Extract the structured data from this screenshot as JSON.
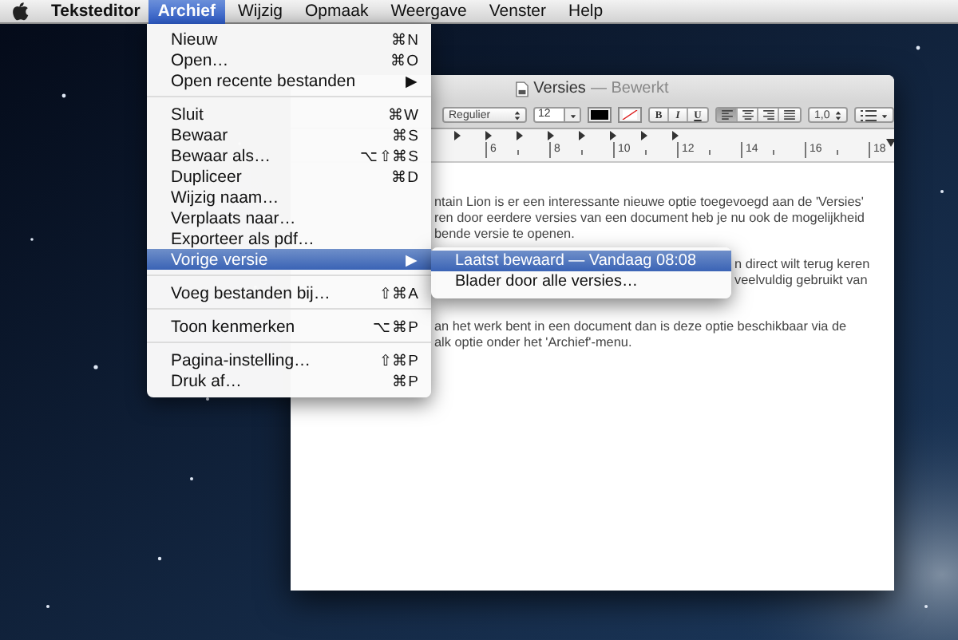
{
  "menubar": {
    "app": "Teksteditor",
    "items": [
      {
        "label": "Archief",
        "selected": true
      },
      {
        "label": "Wijzig",
        "selected": false
      },
      {
        "label": "Opmaak",
        "selected": false
      },
      {
        "label": "Weergave",
        "selected": false
      },
      {
        "label": "Venster",
        "selected": false
      },
      {
        "label": "Help",
        "selected": false
      }
    ]
  },
  "window": {
    "title": "Versies",
    "status": "— Bewerkt",
    "toolbar": {
      "font_style": "Regulier",
      "font_size": "12",
      "style_buttons": [
        "B",
        "I",
        "U"
      ],
      "alignment": [
        {
          "selected": true
        },
        {
          "selected": false
        },
        {
          "selected": false
        },
        {
          "selected": false
        }
      ],
      "line_spacing": "1,0"
    },
    "ruler": [
      "6",
      "8",
      "10",
      "12",
      "14",
      "16",
      "18"
    ],
    "paragraphs": [
      {
        "lines": [
          "ntain Lion is er een interessante nieuwe optie toegevoegd aan de 'Versies'",
          "ren door eerdere versies van een document heb je nu ook de mogelijkheid",
          "bende versie te openen."
        ]
      },
      {
        "lines": [
          "n direct wilt terug keren",
          "veelvuldig gebruikt van"
        ]
      },
      {
        "lines": [
          "an het werk bent in een document dan is deze optie beschikbaar via de",
          "alk optie onder het 'Archief'-menu."
        ]
      }
    ]
  },
  "menu": {
    "groups": [
      [
        {
          "label": "Nieuw",
          "shortcut": "⌘N",
          "selected": false
        },
        {
          "label": "Open…",
          "shortcut": "⌘O",
          "selected": false
        },
        {
          "label": "Open recente bestanden",
          "shortcut": "▶",
          "selected": false
        }
      ],
      [
        {
          "label": "Sluit",
          "shortcut": "⌘W",
          "selected": false
        },
        {
          "label": "Bewaar",
          "shortcut": "⌘S",
          "selected": false
        },
        {
          "label": "Bewaar als…",
          "shortcut": "⌥⇧⌘S",
          "selected": false
        },
        {
          "label": "Dupliceer",
          "shortcut": "⌘D",
          "selected": false
        },
        {
          "label": "Wijzig naam…",
          "selected": false
        },
        {
          "label": "Verplaats naar…",
          "selected": false
        },
        {
          "label": "Exporteer als pdf…",
          "selected": false
        },
        {
          "label": "Vorige versie",
          "shortcut": "▶",
          "selected": true
        }
      ],
      [
        {
          "label": "Voeg bestanden bij…",
          "shortcut": "⇧⌘A",
          "selected": false
        }
      ],
      [
        {
          "label": "Toon kenmerken",
          "shortcut": "⌥⌘P",
          "selected": false
        }
      ],
      [
        {
          "label": "Pagina-instelling…",
          "shortcut": "⇧⌘P",
          "selected": false
        },
        {
          "label": "Druk af…",
          "shortcut": "⌘P",
          "selected": false
        }
      ]
    ]
  },
  "submenu": {
    "items": [
      {
        "label": "Laatst bewaard — Vandaag 08:08",
        "selected": true
      },
      {
        "label": "Blader door alle versies…",
        "selected": false
      }
    ]
  }
}
